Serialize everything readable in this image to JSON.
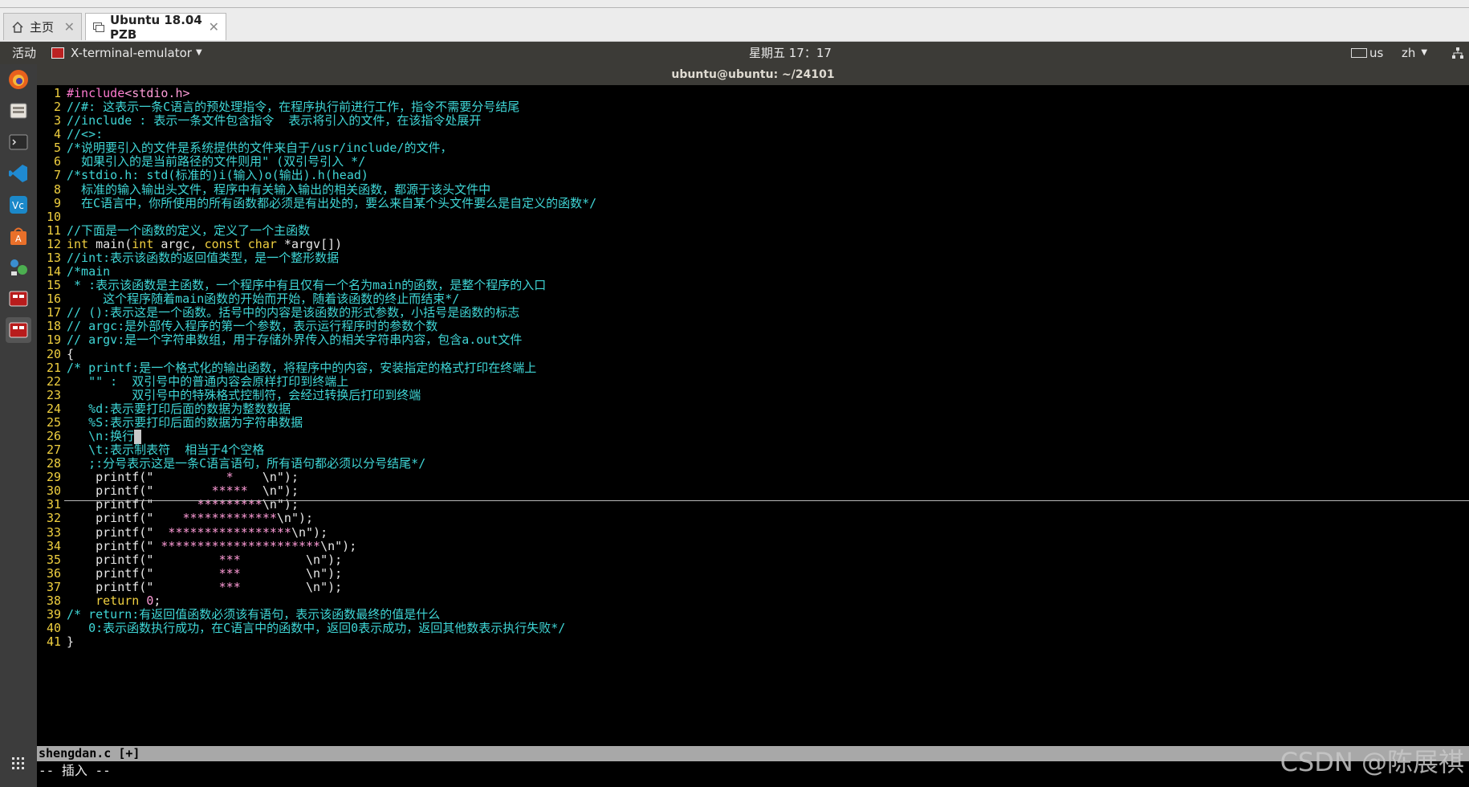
{
  "tabs": [
    {
      "label": "主页",
      "icon": "home-icon"
    },
    {
      "label": "Ubuntu 18.04 PZB",
      "icon": "vm-icon"
    }
  ],
  "topbar": {
    "activities": "活动",
    "app_menu": "X-terminal-emulator",
    "clock": "星期五 17：17",
    "keyboard": "us",
    "input_method": "zh"
  },
  "window_title": "ubuntu@ubuntu: ~/24101",
  "launcher_icons": [
    "firefox-icon",
    "files-icon",
    "terminal-icon",
    "vscode-icon",
    "vc-icon",
    "software-center-icon",
    "network-icon",
    "app-red-icon",
    "app-red-icon-2",
    "show-apps-icon"
  ],
  "editor": {
    "lines": [
      {
        "n": "1",
        "segs": [
          {
            "t": "#include",
            "c": "c-inc"
          },
          {
            "t": "<stdio.h>",
            "c": "c-str"
          }
        ]
      },
      {
        "n": "2",
        "segs": [
          {
            "t": "//#: 这表示一条C语言的预处理指令，在程序执行前进行工作，指令不需要分号结尾",
            "c": ""
          }
        ]
      },
      {
        "n": "3",
        "segs": [
          {
            "t": "//include : 表示一条文件包含指令  表示将引入的文件，在该指令处展开",
            "c": ""
          }
        ]
      },
      {
        "n": "4",
        "segs": [
          {
            "t": "//<>:",
            "c": ""
          }
        ]
      },
      {
        "n": "5",
        "segs": [
          {
            "t": "/*说明要引入的文件是系统提供的文件来自于/usr/include/的文件，",
            "c": ""
          }
        ]
      },
      {
        "n": "6",
        "segs": [
          {
            "t": "  如果引入的是当前路径的文件则用\" (双引号引入 */",
            "c": ""
          }
        ]
      },
      {
        "n": "7",
        "segs": [
          {
            "t": "/*stdio.h: std(标准的)i(输入)o(输出).h(head)",
            "c": ""
          }
        ]
      },
      {
        "n": "8",
        "segs": [
          {
            "t": "  标准的输入输出头文件，程序中有关输入输出的相关函数，都源于该头文件中",
            "c": ""
          }
        ]
      },
      {
        "n": "9",
        "segs": [
          {
            "t": "  在C语言中，你所使用的所有函数都必须是有出处的，要么来自某个头文件要么是自定义的函数*/",
            "c": ""
          }
        ]
      },
      {
        "n": "10",
        "segs": []
      },
      {
        "n": "11",
        "segs": [
          {
            "t": "//下面是一个函数的定义，定义了一个主函数",
            "c": ""
          }
        ]
      },
      {
        "n": "12",
        "segs": [
          {
            "t": "int",
            "c": "c-kw"
          },
          {
            "t": " main(",
            "c": "c-plain"
          },
          {
            "t": "int",
            "c": "c-kw"
          },
          {
            "t": " argc, ",
            "c": "c-plain"
          },
          {
            "t": "const char",
            "c": "c-kw"
          },
          {
            "t": " *argv[])",
            "c": "c-plain"
          }
        ]
      },
      {
        "n": "13",
        "segs": [
          {
            "t": "//int:表示该函数的返回值类型，是一个整形数据",
            "c": ""
          }
        ]
      },
      {
        "n": "14",
        "segs": [
          {
            "t": "/*main",
            "c": ""
          }
        ]
      },
      {
        "n": "15",
        "segs": [
          {
            "t": " * :表示该函数是主函数，一个程序中有且仅有一个名为main的函数，是整个程序的入口",
            "c": ""
          }
        ]
      },
      {
        "n": "16",
        "segs": [
          {
            "t": "     这个程序随着main函数的开始而开始，随着该函数的终止而结束*/",
            "c": ""
          }
        ]
      },
      {
        "n": "17",
        "segs": [
          {
            "t": "// ():表示这是一个函数。括号中的内容是该函数的形式参数，小括号是函数的标志",
            "c": ""
          }
        ]
      },
      {
        "n": "18",
        "segs": [
          {
            "t": "// argc:是外部传入程序的第一个参数，表示运行程序时的参数个数",
            "c": ""
          }
        ]
      },
      {
        "n": "19",
        "segs": [
          {
            "t": "// argv:是一个字符串数组，用于存储外界传入的相关字符串内容，包含a.out文件",
            "c": ""
          }
        ]
      },
      {
        "n": "20",
        "segs": [
          {
            "t": "{",
            "c": "c-plain"
          }
        ]
      },
      {
        "n": "21",
        "segs": [
          {
            "t": "/* printf:是一个格式化的输出函数，将程序中的内容，安装指定的格式打印在终端上",
            "c": ""
          }
        ]
      },
      {
        "n": "22",
        "segs": [
          {
            "t": "   \"\" :  双引号中的普通内容会原样打印到终端上",
            "c": ""
          }
        ]
      },
      {
        "n": "23",
        "segs": [
          {
            "t": "         双引号中的特殊格式控制符，会经过转换后打印到终端",
            "c": ""
          }
        ]
      },
      {
        "n": "24",
        "segs": [
          {
            "t": "   %d:表示要打印后面的数据为整数数据",
            "c": ""
          }
        ]
      },
      {
        "n": "25",
        "segs": [
          {
            "t": "   %S:表示要打印后面的数据为字符串数据",
            "c": ""
          }
        ]
      },
      {
        "n": "26",
        "segs": [
          {
            "t": "   \\n:换行",
            "c": ""
          }
        ],
        "cursor": true
      },
      {
        "n": "27",
        "segs": [
          {
            "t": "   \\t:表示制表符  相当于4个空格",
            "c": ""
          }
        ]
      },
      {
        "n": "28",
        "segs": [
          {
            "t": "   ;:分号表示这是一条C语言语句，所有语句都必须以分号结尾*/",
            "c": ""
          }
        ]
      },
      {
        "n": "29",
        "segs": [
          {
            "t": "    printf(\"",
            "c": "c-plain"
          },
          {
            "t": "          *    ",
            "c": "c-str"
          },
          {
            "t": "\\n",
            "c": "c-plain"
          },
          {
            "t": "\");",
            "c": "c-plain"
          }
        ]
      },
      {
        "n": "30",
        "segs": [
          {
            "t": "    printf(\"",
            "c": "c-plain"
          },
          {
            "t": "        *****  ",
            "c": "c-str"
          },
          {
            "t": "\\n",
            "c": "c-plain"
          },
          {
            "t": "\");",
            "c": "c-plain"
          }
        ]
      },
      {
        "n": "31",
        "segs": [
          {
            "t": "    printf(\"",
            "c": "c-plain"
          },
          {
            "t": "      *********",
            "c": "c-str"
          },
          {
            "t": "\\n",
            "c": "c-plain"
          },
          {
            "t": "\");",
            "c": "c-plain"
          }
        ]
      },
      {
        "n": "32",
        "segs": [
          {
            "t": "    printf(\"",
            "c": "c-plain"
          },
          {
            "t": "    *************",
            "c": "c-str"
          },
          {
            "t": "\\n",
            "c": "c-plain"
          },
          {
            "t": "\");",
            "c": "c-plain"
          }
        ]
      },
      {
        "n": "33",
        "segs": [
          {
            "t": "    printf(\"",
            "c": "c-plain"
          },
          {
            "t": "  *****************",
            "c": "c-str"
          },
          {
            "t": "\\n",
            "c": "c-plain"
          },
          {
            "t": "\");",
            "c": "c-plain"
          }
        ]
      },
      {
        "n": "34",
        "segs": [
          {
            "t": "    printf(\"",
            "c": "c-plain"
          },
          {
            "t": " **********************",
            "c": "c-str"
          },
          {
            "t": "\\n",
            "c": "c-plain"
          },
          {
            "t": "\");",
            "c": "c-plain"
          }
        ]
      },
      {
        "n": "35",
        "segs": [
          {
            "t": "    printf(\"",
            "c": "c-plain"
          },
          {
            "t": "         ***         ",
            "c": "c-str"
          },
          {
            "t": "\\n",
            "c": "c-plain"
          },
          {
            "t": "\");",
            "c": "c-plain"
          }
        ]
      },
      {
        "n": "36",
        "segs": [
          {
            "t": "    printf(\"",
            "c": "c-plain"
          },
          {
            "t": "         ***         ",
            "c": "c-str"
          },
          {
            "t": "\\n",
            "c": "c-plain"
          },
          {
            "t": "\");",
            "c": "c-plain"
          }
        ]
      },
      {
        "n": "37",
        "segs": [
          {
            "t": "    printf(\"",
            "c": "c-plain"
          },
          {
            "t": "         ***         ",
            "c": "c-str"
          },
          {
            "t": "\\n",
            "c": "c-plain"
          },
          {
            "t": "\");",
            "c": "c-plain"
          }
        ]
      },
      {
        "n": "38",
        "segs": [
          {
            "t": "    ",
            "c": "c-plain"
          },
          {
            "t": "return",
            "c": "c-kw"
          },
          {
            "t": " ",
            "c": "c-plain"
          },
          {
            "t": "0",
            "c": "c-str"
          },
          {
            "t": ";",
            "c": "c-plain"
          }
        ]
      },
      {
        "n": "39",
        "segs": [
          {
            "t": "/* return:有返回值函数必须该有语句，表示该函数最终的值是什么",
            "c": ""
          }
        ]
      },
      {
        "n": "40",
        "segs": [
          {
            "t": "   0:表示函数执行成功，在C语言中的函数中，返回0表示成功，返回其他数表示执行失败*/",
            "c": ""
          }
        ]
      },
      {
        "n": "41",
        "segs": [
          {
            "t": "}",
            "c": "c-plain"
          }
        ]
      }
    ],
    "statusline": "shengdan.c [+]",
    "mode": "-- 插入 --"
  },
  "watermark": "CSDN @陈展祺"
}
